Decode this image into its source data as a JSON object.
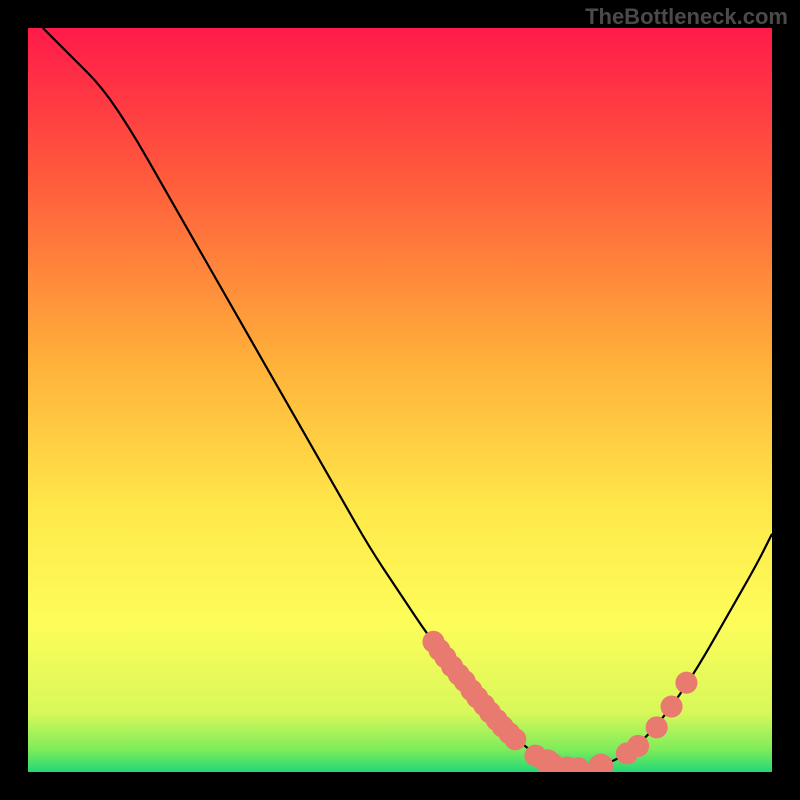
{
  "watermark": "TheBottleneck.com",
  "chart_data": {
    "type": "line",
    "title": "",
    "xlabel": "",
    "ylabel": "",
    "xlim": [
      0,
      100
    ],
    "ylim": [
      0,
      100
    ],
    "gradient_stops": [
      {
        "offset": 0,
        "color": "#ff1a4a"
      },
      {
        "offset": 20,
        "color": "#ff5a3c"
      },
      {
        "offset": 45,
        "color": "#ffb13a"
      },
      {
        "offset": 65,
        "color": "#ffe94a"
      },
      {
        "offset": 80,
        "color": "#fdfd5a"
      },
      {
        "offset": 92,
        "color": "#d8f85a"
      },
      {
        "offset": 97,
        "color": "#7eec5a"
      },
      {
        "offset": 100,
        "color": "#22d877"
      }
    ],
    "curve": [
      {
        "x": 2,
        "y": 100
      },
      {
        "x": 6,
        "y": 96
      },
      {
        "x": 10,
        "y": 92
      },
      {
        "x": 14,
        "y": 86
      },
      {
        "x": 18,
        "y": 79
      },
      {
        "x": 22,
        "y": 72
      },
      {
        "x": 26,
        "y": 65
      },
      {
        "x": 30,
        "y": 58
      },
      {
        "x": 34,
        "y": 51
      },
      {
        "x": 38,
        "y": 44
      },
      {
        "x": 42,
        "y": 37
      },
      {
        "x": 46,
        "y": 30
      },
      {
        "x": 50,
        "y": 24
      },
      {
        "x": 54,
        "y": 18
      },
      {
        "x": 58,
        "y": 13
      },
      {
        "x": 62,
        "y": 8
      },
      {
        "x": 66,
        "y": 4
      },
      {
        "x": 70,
        "y": 1.2
      },
      {
        "x": 74,
        "y": 0.5
      },
      {
        "x": 78,
        "y": 1.0
      },
      {
        "x": 82,
        "y": 3.5
      },
      {
        "x": 86,
        "y": 8
      },
      {
        "x": 90,
        "y": 14
      },
      {
        "x": 94,
        "y": 21
      },
      {
        "x": 98,
        "y": 28
      },
      {
        "x": 100,
        "y": 32
      }
    ],
    "markers": [
      {
        "x": 54.5,
        "y": 17.5,
        "r": 1.2
      },
      {
        "x": 55.3,
        "y": 16.4,
        "r": 1.2
      },
      {
        "x": 56.1,
        "y": 15.4,
        "r": 1.2
      },
      {
        "x": 57.0,
        "y": 14.2,
        "r": 1.2
      },
      {
        "x": 57.9,
        "y": 13.1,
        "r": 1.2
      },
      {
        "x": 58.7,
        "y": 12.2,
        "r": 1.2
      },
      {
        "x": 59.6,
        "y": 11.0,
        "r": 1.2
      },
      {
        "x": 60.4,
        "y": 10.0,
        "r": 1.2
      },
      {
        "x": 61.3,
        "y": 9.0,
        "r": 1.2
      },
      {
        "x": 62.1,
        "y": 8.0,
        "r": 1.2
      },
      {
        "x": 63.0,
        "y": 7.0,
        "r": 1.2
      },
      {
        "x": 63.8,
        "y": 6.1,
        "r": 1.2
      },
      {
        "x": 64.7,
        "y": 5.2,
        "r": 1.2
      },
      {
        "x": 65.5,
        "y": 4.4,
        "r": 1.2
      },
      {
        "x": 68.2,
        "y": 2.2,
        "r": 1.2
      },
      {
        "x": 69.8,
        "y": 1.4,
        "r": 1.4
      },
      {
        "x": 70.5,
        "y": 1.1,
        "r": 1.2
      },
      {
        "x": 72.5,
        "y": 0.6,
        "r": 1.2
      },
      {
        "x": 74.0,
        "y": 0.5,
        "r": 1.2
      },
      {
        "x": 77.0,
        "y": 0.8,
        "r": 1.4
      },
      {
        "x": 80.5,
        "y": 2.5,
        "r": 1.2
      },
      {
        "x": 82.0,
        "y": 3.5,
        "r": 1.2
      },
      {
        "x": 84.5,
        "y": 6.0,
        "r": 1.2
      },
      {
        "x": 86.5,
        "y": 8.8,
        "r": 1.2
      },
      {
        "x": 88.5,
        "y": 12.0,
        "r": 1.2
      }
    ],
    "marker_color": "#e87a6f",
    "curve_color": "#000000"
  }
}
